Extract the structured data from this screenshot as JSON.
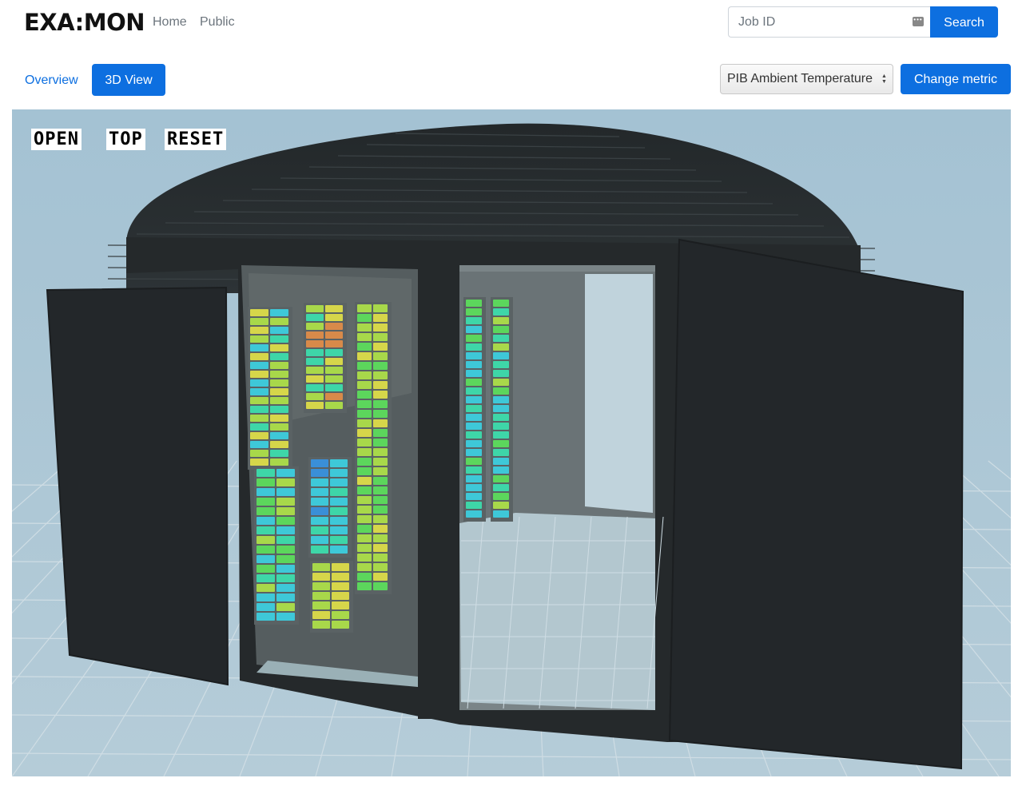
{
  "navbar": {
    "brand": "EXA:MON",
    "links": [
      "Home",
      "Public"
    ],
    "search": {
      "placeholder": "Job ID",
      "button_label": "Search"
    }
  },
  "toolbar": {
    "tabs": [
      "Overview",
      "3D View"
    ],
    "active_tab": "3D View",
    "metric_selected": "PIB Ambient Temperature",
    "change_metric_label": "Change metric"
  },
  "viewport": {
    "camera_buttons": [
      "OPEN",
      "TOP",
      "RESET"
    ]
  },
  "colors": {
    "accent": "#0d6fe0",
    "sky": "#a8c4d4",
    "cabinet": "#262b2d",
    "heat_scale": [
      "#3a8fd8",
      "#3ec8d8",
      "#3ed6a8",
      "#5cd65c",
      "#a8d84a",
      "#d6d64a",
      "#d88a4a",
      "#d85a4a"
    ]
  }
}
